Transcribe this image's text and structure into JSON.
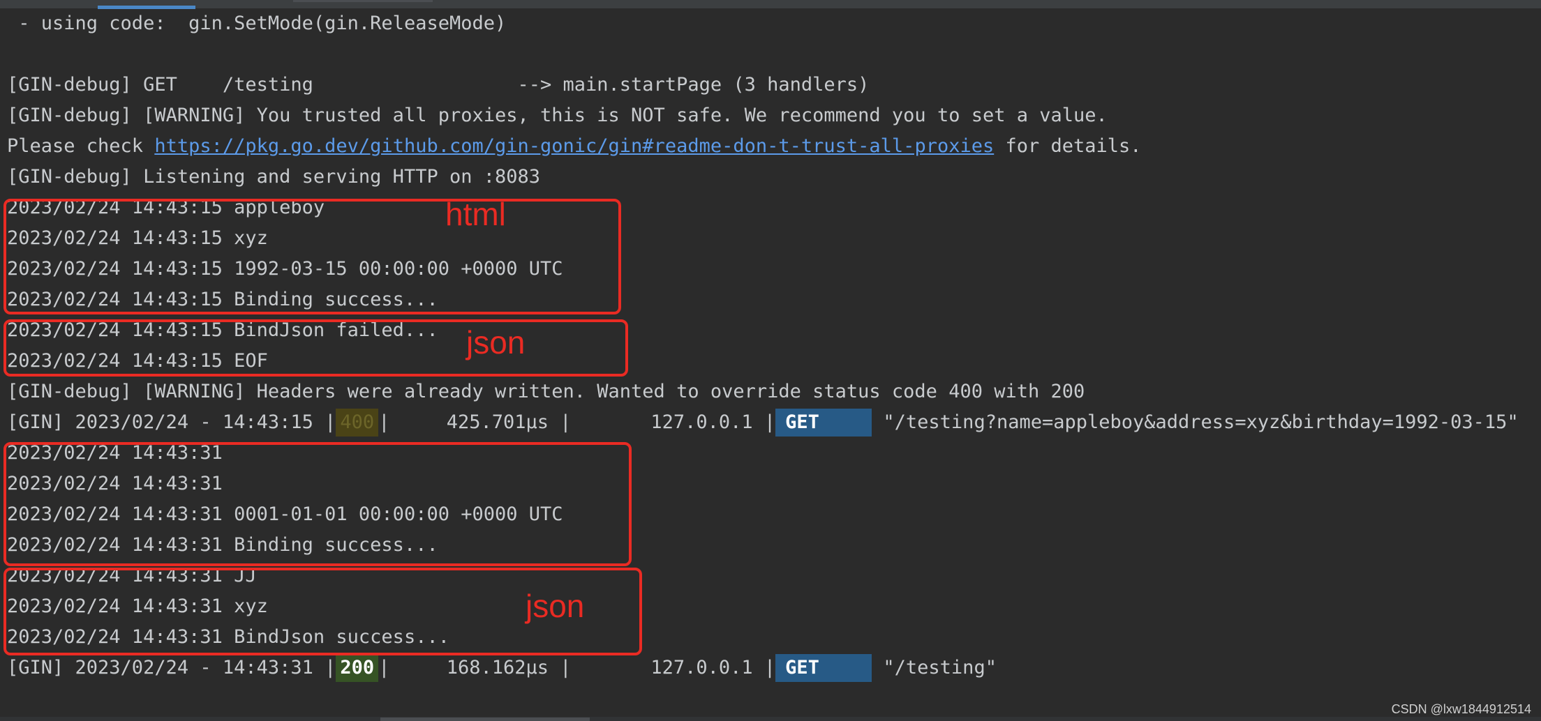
{
  "lines": [
    " - using code:  gin.SetMode(gin.ReleaseMode)",
    "",
    "[GIN-debug] GET    /testing                  --> main.startPage (3 handlers)",
    "[GIN-debug] [WARNING] You trusted all proxies, this is NOT safe. We recommend you to set a value.",
    "",
    "[GIN-debug] Listening and serving HTTP on :8083",
    "2023/02/24 14:43:15 appleboy",
    "2023/02/24 14:43:15 xyz",
    "2023/02/24 14:43:15 1992-03-15 00:00:00 +0000 UTC",
    "2023/02/24 14:43:15 Binding success...",
    "2023/02/24 14:43:15 BindJson failed...",
    "2023/02/24 14:43:15 EOF",
    "[GIN-debug] [WARNING] Headers were already written. Wanted to override status code 400 with 200",
    "",
    "2023/02/24 14:43:31",
    "2023/02/24 14:43:31",
    "2023/02/24 14:43:31 0001-01-01 00:00:00 +0000 UTC",
    "2023/02/24 14:43:31 Binding success...",
    "2023/02/24 14:43:31 JJ",
    "2023/02/24 14:43:31 xyz",
    "2023/02/24 14:43:31 BindJson success...",
    ""
  ],
  "proxy_line": {
    "prefix": "Please check ",
    "link": "https://pkg.go.dev/github.com/gin-gonic/gin#readme-don-t-trust-all-proxies",
    "suffix": " for details."
  },
  "requests": [
    {
      "prefix": "[GIN] 2023/02/24 - 14:43:15 |",
      "status": "400",
      "latency": "|     425.701µs |       127.0.0.1 |",
      "method": "GET",
      "path": " \"/testing?name=appleboy&address=xyz&birthday=1992-03-15\""
    },
    {
      "prefix": "[GIN] 2023/02/24 - 14:43:31 |",
      "status": "200",
      "latency": "|     168.162µs |       127.0.0.1 |",
      "method": "GET",
      "path": " \"/testing\""
    }
  ],
  "annotations": [
    "html",
    "json",
    "json"
  ],
  "colors": {
    "background": "#2b2b2b",
    "text": "#c8cbce",
    "link": "#5c9bea",
    "annotation": "#ea2b23",
    "status_400_bg": "#4a4316",
    "status_200_bg": "#365325",
    "method_bg": "#275a86"
  },
  "watermark": "CSDN @lxw1844912514"
}
